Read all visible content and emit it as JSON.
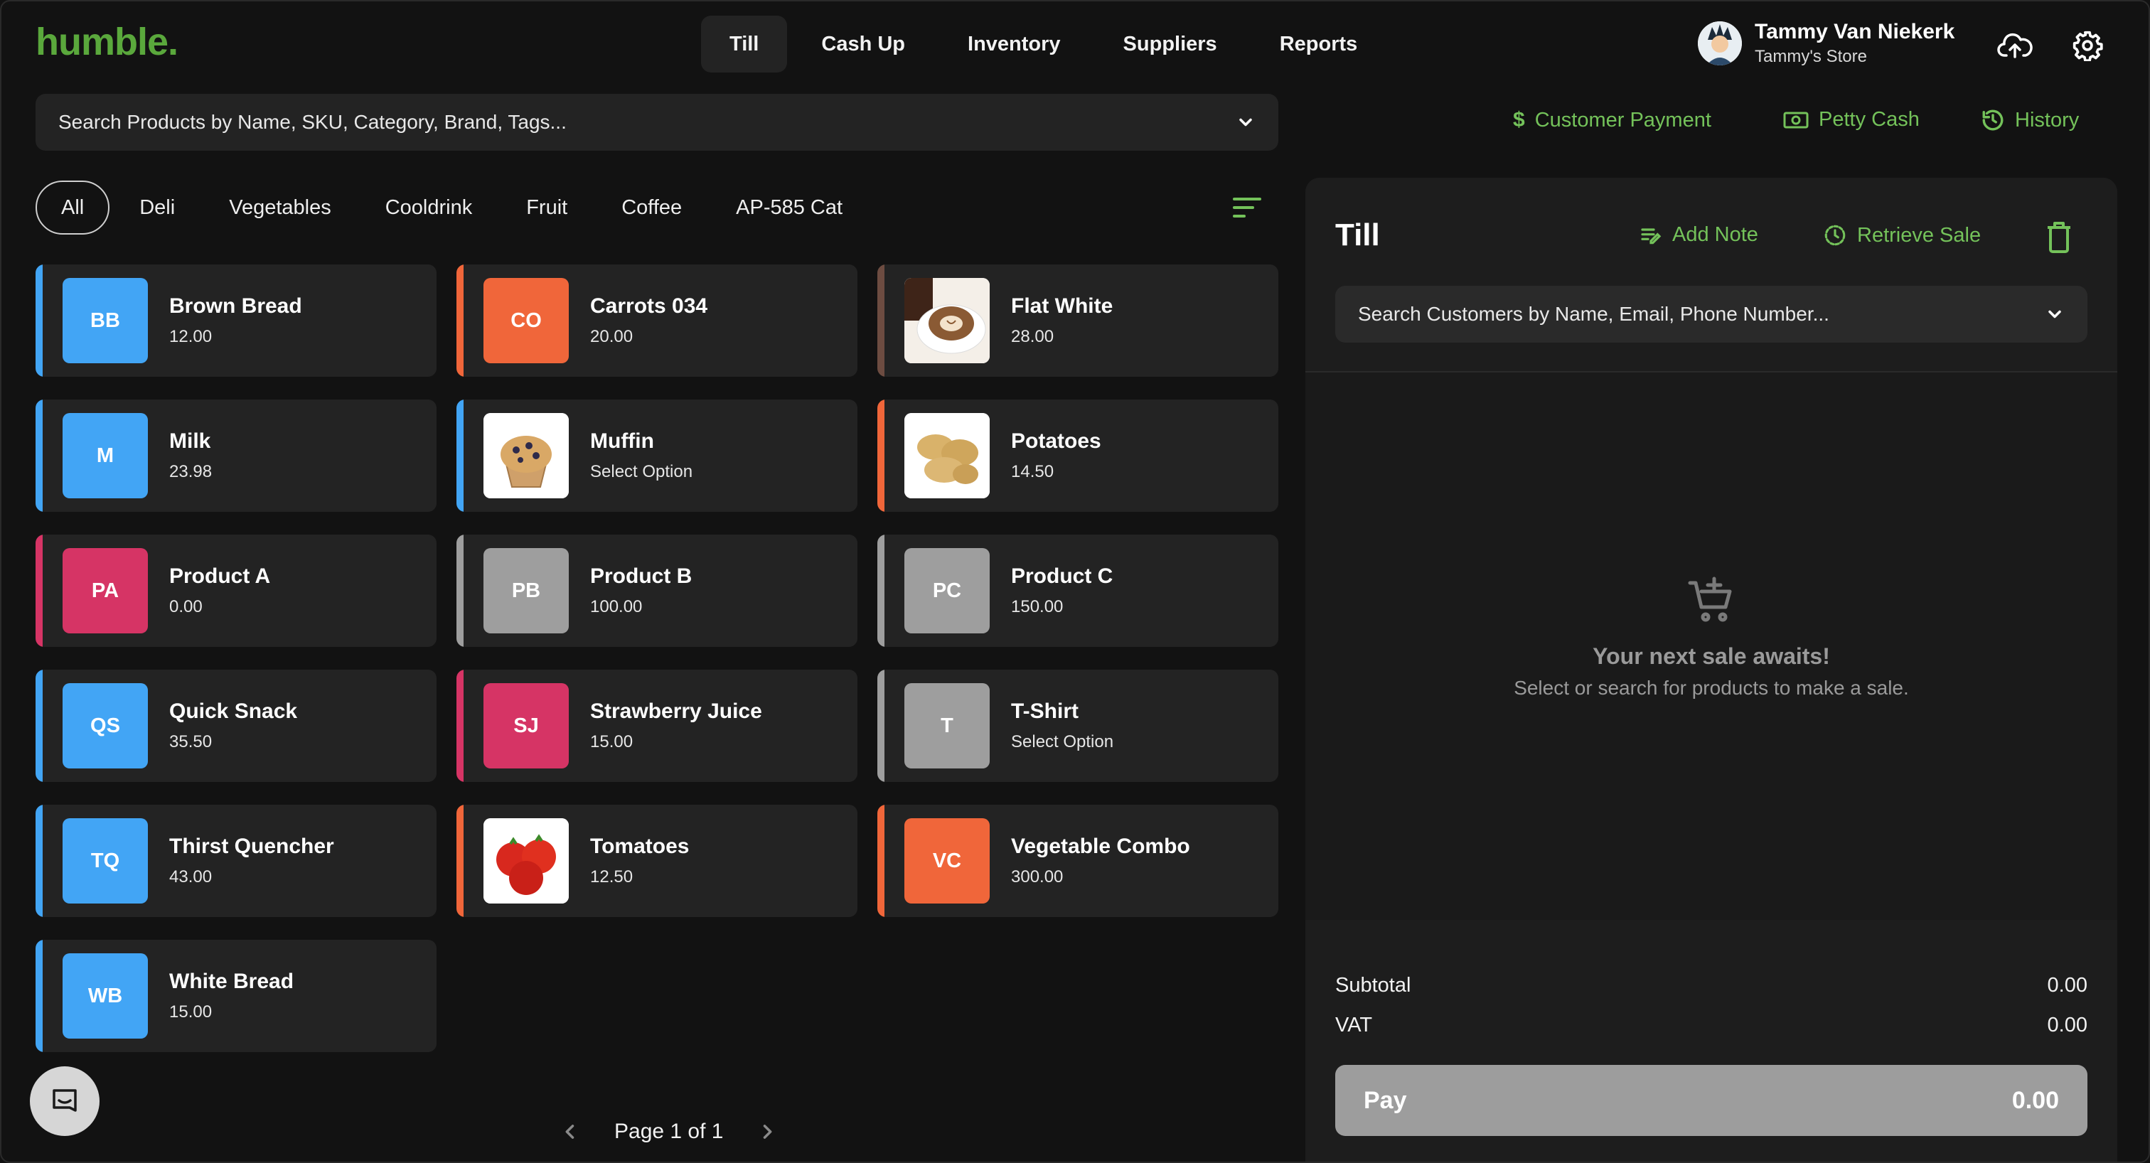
{
  "brand": {
    "logo_text": "humble."
  },
  "nav": {
    "tabs": [
      {
        "label": "Till",
        "active": true
      },
      {
        "label": "Cash Up"
      },
      {
        "label": "Inventory"
      },
      {
        "label": "Suppliers"
      },
      {
        "label": "Reports"
      }
    ]
  },
  "user": {
    "name": "Tammy Van Niekerk",
    "store": "Tammy's Store"
  },
  "product_search": {
    "placeholder": "Search Products by Name, SKU, Category, Brand, Tags..."
  },
  "categories": [
    "All",
    "Deli",
    "Vegetables",
    "Cooldrink",
    "Fruit",
    "Coffee",
    "AP-585 Cat"
  ],
  "products": [
    {
      "name": "Brown Bread",
      "price": "12.00",
      "initials": "BB",
      "color": "#42a5f5"
    },
    {
      "name": "Carrots 034",
      "price": "20.00",
      "initials": "CO",
      "color": "#f0663a"
    },
    {
      "name": "Flat White",
      "price": "28.00",
      "image": "coffee",
      "color": "#6d4c41"
    },
    {
      "name": "Milk",
      "price": "23.98",
      "initials": "M",
      "color": "#42a5f5"
    },
    {
      "name": "Muffin",
      "price": "Select Option",
      "image": "muffin",
      "color": "#42a5f5"
    },
    {
      "name": "Potatoes",
      "price": "14.50",
      "image": "potatoes",
      "color": "#f0663a"
    },
    {
      "name": "Product A",
      "price": "0.00",
      "initials": "PA",
      "color": "#d63465"
    },
    {
      "name": "Product B",
      "price": "100.00",
      "initials": "PB",
      "color": "#9e9e9e"
    },
    {
      "name": "Product C",
      "price": "150.00",
      "initials": "PC",
      "color": "#9e9e9e"
    },
    {
      "name": "Quick Snack",
      "price": "35.50",
      "initials": "QS",
      "color": "#42a5f5"
    },
    {
      "name": "Strawberry Juice",
      "price": "15.00",
      "initials": "SJ",
      "color": "#d63465"
    },
    {
      "name": "T-Shirt",
      "price": "Select Option",
      "initials": "T",
      "color": "#9e9e9e"
    },
    {
      "name": "Thirst Quencher",
      "price": "43.00",
      "initials": "TQ",
      "color": "#42a5f5"
    },
    {
      "name": "Tomatoes",
      "price": "12.50",
      "image": "tomatoes",
      "color": "#f0663a"
    },
    {
      "name": "Vegetable Combo",
      "price": "300.00",
      "initials": "VC",
      "color": "#f0663a"
    },
    {
      "name": "White Bread",
      "price": "15.00",
      "initials": "WB",
      "color": "#42a5f5"
    }
  ],
  "pager": {
    "label": "Page 1 of 1"
  },
  "quick_actions": {
    "customer_payment": "Customer Payment",
    "petty_cash": "Petty Cash",
    "history": "History"
  },
  "till": {
    "title": "Till",
    "add_note": "Add Note",
    "retrieve_sale": "Retrieve Sale",
    "customer_search_placeholder": "Search Customers by Name, Email, Phone Number...",
    "empty_title": "Your next sale awaits!",
    "empty_subtitle": "Select or search for products to make a sale.",
    "subtotal_label": "Subtotal",
    "subtotal_value": "0.00",
    "vat_label": "VAT",
    "vat_value": "0.00",
    "pay_label": "Pay",
    "pay_value": "0.00"
  },
  "colors": {
    "accent_green": "#74c25a",
    "logo_green": "#5aa83c",
    "background": "#121212",
    "card": "#232323"
  }
}
